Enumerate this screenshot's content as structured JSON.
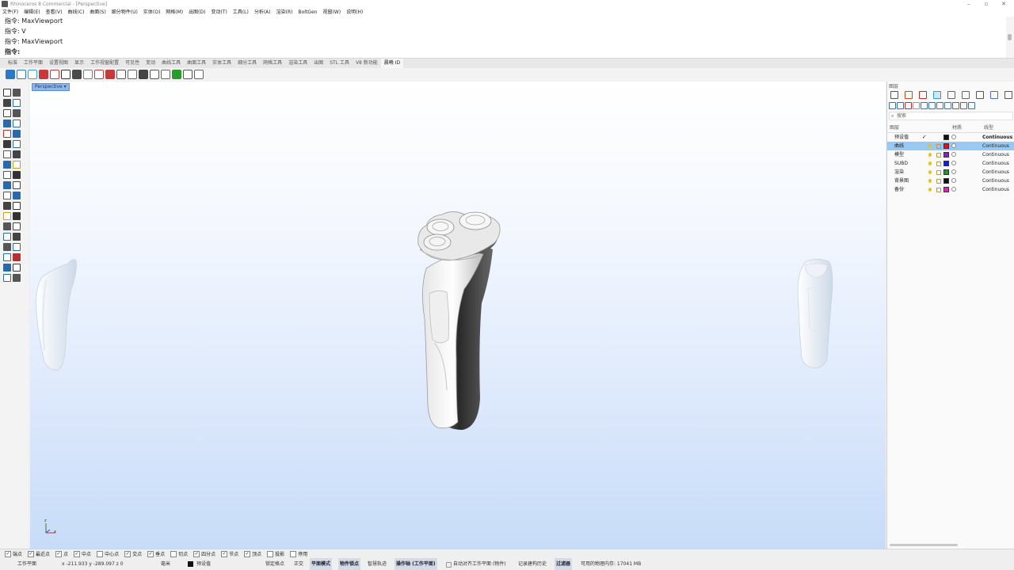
{
  "window": {
    "title": "Rhinoceros 8 Commercial - [Perspective]"
  },
  "menu": [
    "文件(F)",
    "编辑(E)",
    "查看(V)",
    "曲线(C)",
    "曲面(S)",
    "细分物件(U)",
    "实体(O)",
    "网格(M)",
    "出图(D)",
    "变动(T)",
    "工具(L)",
    "分析(A)",
    "渲染(R)",
    "BoltGen",
    "视窗(W)",
    "说明(H)"
  ],
  "command_history": [
    "指令: MaxViewport",
    "指令: V",
    "指令: MaxViewport"
  ],
  "command_prompt": "指令:",
  "tabs": [
    "标准",
    "工作平面",
    "设置视图",
    "显示",
    "工作视窗配置",
    "可见性",
    "变动",
    "曲线工具",
    "曲面工具",
    "实体工具",
    "细分工具",
    "网格工具",
    "渲染工具",
    "出图",
    "STL 工具",
    "V8 新功能",
    "晨曦 ID"
  ],
  "active_tab_index": 16,
  "viewport": {
    "label": "Perspective"
  },
  "axis": {
    "z": "z",
    "x": "x"
  },
  "layers_panel": {
    "title": "图层",
    "search_placeholder": "搜索",
    "columns": {
      "name": "图层",
      "material": "材质",
      "linetype": "线型"
    },
    "layers": [
      {
        "name": "预设值",
        "current": true,
        "selected": false,
        "color": "#111111",
        "linetype": "Continuous"
      },
      {
        "name": "曲线",
        "current": false,
        "selected": true,
        "color": "#d01a1a",
        "linetype": "Continuous"
      },
      {
        "name": "模型",
        "current": false,
        "selected": false,
        "color": "#8a1fc9",
        "linetype": "Continuous"
      },
      {
        "name": "SUBD",
        "current": false,
        "selected": false,
        "color": "#1522c8",
        "linetype": "Continuous"
      },
      {
        "name": "渲染",
        "current": false,
        "selected": false,
        "color": "#1e9a1e",
        "linetype": "Continuous"
      },
      {
        "name": "背景图",
        "current": false,
        "selected": false,
        "color": "#111111",
        "linetype": "Continuous"
      },
      {
        "name": "备份",
        "current": false,
        "selected": false,
        "color": "#e61ebe",
        "linetype": "Continuous"
      }
    ]
  },
  "osnaps": [
    {
      "label": "端点",
      "checked": true
    },
    {
      "label": "最近点",
      "checked": true
    },
    {
      "label": "点",
      "checked": true
    },
    {
      "label": "中点",
      "checked": true
    },
    {
      "label": "中心点",
      "checked": false
    },
    {
      "label": "交点",
      "checked": true
    },
    {
      "label": "垂点",
      "checked": true
    },
    {
      "label": "切点",
      "checked": false
    },
    {
      "label": "四分点",
      "checked": true
    },
    {
      "label": "节点",
      "checked": true
    },
    {
      "label": "顶点",
      "checked": true
    },
    {
      "label": "投影",
      "checked": false
    },
    {
      "label": "停用",
      "checked": false
    }
  ],
  "status": {
    "cplane": "工作平面",
    "coords": "x -211.933  y -289.097  z 0",
    "units": "毫米",
    "layer": "预设值",
    "lock_grid": "锁定格点",
    "ortho": "正交",
    "planar": "平面模式",
    "osnap": "物件锁点",
    "smarttrack": "智慧轨迹",
    "gumball": "操作轴 (工作平面)",
    "autocplane": "自动对齐工作平面 (物件)",
    "history": "记录建构历史",
    "filter": "过滤器",
    "memory": "可用的物理内存: 17041 MB"
  },
  "colors": {
    "accent": "#99c8f2",
    "viewport_bottom": "#c7dcf8"
  }
}
